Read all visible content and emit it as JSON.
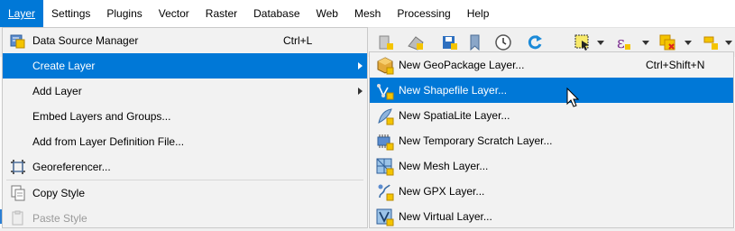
{
  "menubar": [
    {
      "label": "Layer",
      "active": true
    },
    {
      "label": "Settings"
    },
    {
      "label": "Plugins"
    },
    {
      "label": "Vector"
    },
    {
      "label": "Raster"
    },
    {
      "label": "Database"
    },
    {
      "label": "Web"
    },
    {
      "label": "Mesh"
    },
    {
      "label": "Processing"
    },
    {
      "label": "Help"
    }
  ],
  "layer_menu": {
    "items": [
      {
        "label": "Data Source Manager",
        "shortcut": "Ctrl+L",
        "icon": "data-source-manager-icon"
      },
      {
        "label": "Create Layer",
        "has_submenu": true,
        "highlighted": true
      },
      {
        "label": "Add Layer",
        "has_submenu": true
      },
      {
        "label": "Embed Layers and Groups..."
      },
      {
        "label": "Add from Layer Definition File..."
      },
      {
        "label": "Georeferencer...",
        "icon": "georeferencer-icon"
      },
      {
        "label": "Copy Style",
        "icon": "copy-style-icon"
      },
      {
        "label": "Paste Style",
        "icon": "paste-style-icon",
        "disabled": true
      }
    ]
  },
  "create_layer_submenu": {
    "items": [
      {
        "label": "New GeoPackage Layer...",
        "shortcut": "Ctrl+Shift+N",
        "icon": "geopackage-icon"
      },
      {
        "label": "New Shapefile Layer...",
        "icon": "shapefile-icon",
        "highlighted": true
      },
      {
        "label": "New SpatiaLite Layer...",
        "icon": "spatialite-icon"
      },
      {
        "label": "New Temporary Scratch Layer...",
        "icon": "scratch-layer-icon"
      },
      {
        "label": "New Mesh Layer...",
        "icon": "mesh-layer-icon"
      },
      {
        "label": "New GPX Layer...",
        "icon": "gpx-layer-icon"
      },
      {
        "label": "New Virtual Layer...",
        "icon": "virtual-layer-icon"
      }
    ]
  },
  "colors": {
    "highlight": "#0078d7",
    "menu_bg": "#f2f2f2",
    "disabled_text": "#9a9a9a"
  }
}
